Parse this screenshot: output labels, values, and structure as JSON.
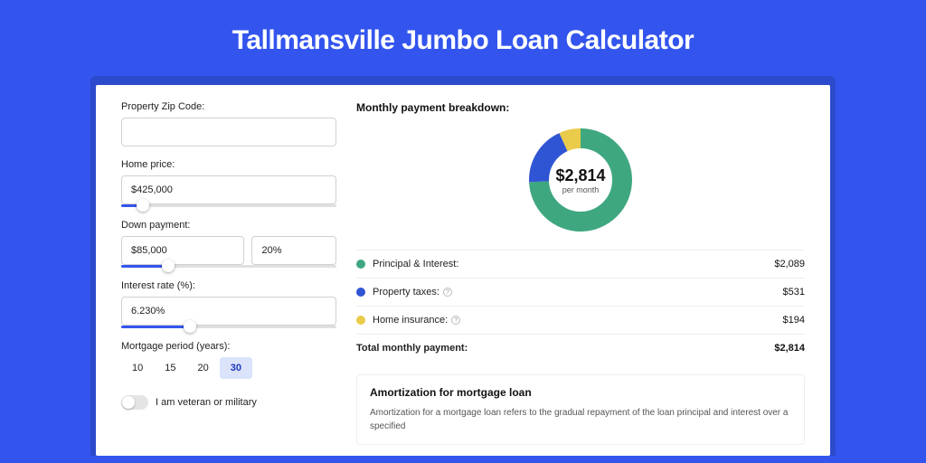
{
  "title": "Tallmansville Jumbo Loan Calculator",
  "form": {
    "zip": {
      "label": "Property Zip Code:",
      "value": ""
    },
    "home_price": {
      "label": "Home price:",
      "value": "$425,000",
      "slider_pct": 10
    },
    "down_payment": {
      "label": "Down payment:",
      "amount": "$85,000",
      "pct": "20%",
      "slider_pct": 22
    },
    "interest": {
      "label": "Interest rate (%):",
      "value": "6.230%",
      "slider_pct": 32
    },
    "period": {
      "label": "Mortgage period (years):",
      "options": [
        "10",
        "15",
        "20",
        "30"
      ],
      "active": "30"
    },
    "veteran_label": "I am veteran or military"
  },
  "breakdown": {
    "title": "Monthly payment breakdown:",
    "center_amount": "$2,814",
    "center_sub": "per month",
    "rows": [
      {
        "label": "Principal & Interest:",
        "value": "$2,089",
        "color": "#3fa77f",
        "info": false
      },
      {
        "label": "Property taxes:",
        "value": "$531",
        "color": "#2f55d4",
        "info": true
      },
      {
        "label": "Home insurance:",
        "value": "$194",
        "color": "#eacb4a",
        "info": true
      }
    ],
    "total": {
      "label": "Total monthly payment:",
      "value": "$2,814"
    }
  },
  "chart_data": {
    "type": "pie",
    "title": "Monthly payment breakdown",
    "series": [
      {
        "name": "Principal & Interest",
        "value": 2089,
        "color": "#3fa77f"
      },
      {
        "name": "Property taxes",
        "value": 531,
        "color": "#2f55d4"
      },
      {
        "name": "Home insurance",
        "value": 194,
        "color": "#eacb4a"
      }
    ],
    "total": 2814,
    "center_label": "$2,814 per month"
  },
  "amort": {
    "title": "Amortization for mortgage loan",
    "text": "Amortization for a mortgage loan refers to the gradual repayment of the loan principal and interest over a specified"
  }
}
